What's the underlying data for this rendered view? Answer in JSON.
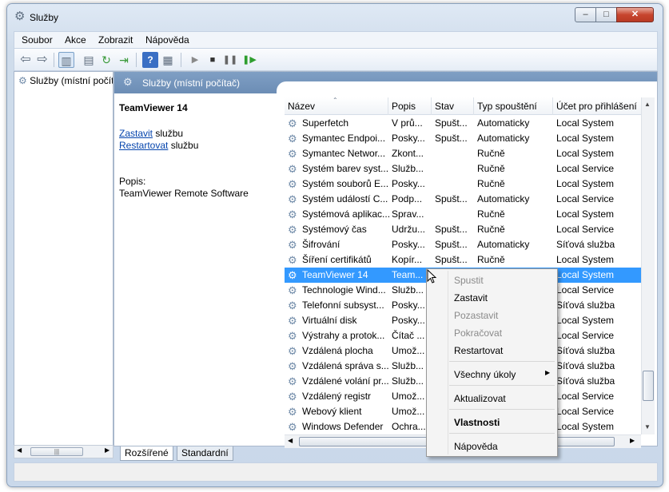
{
  "window": {
    "title": "Služby",
    "controls": {
      "minimize": "–",
      "maximize": "□",
      "close": "✕"
    }
  },
  "menu": [
    "Soubor",
    "Akce",
    "Zobrazit",
    "Nápověda"
  ],
  "toolbar": {
    "buttons": [
      "back-icon",
      "forward-icon",
      "console-tree-icon",
      "properties-icon",
      "refresh-icon",
      "export-icon",
      "help-icon",
      "view-icon",
      "play-icon",
      "stop-icon",
      "pause-icon",
      "resume-icon"
    ]
  },
  "left_pane": {
    "item": "Služby (místní počítač)"
  },
  "right_pane": {
    "title": "Služby (místní počítač)",
    "selected_service": "TeamViewer 14",
    "actions": [
      {
        "link": "Zastavit",
        "suffix": " službu"
      },
      {
        "link": "Restartovat",
        "suffix": " službu"
      }
    ],
    "description_label": "Popis:",
    "description": "TeamViewer Remote Software"
  },
  "table": {
    "columns": [
      "Název",
      "Popis",
      "Stav",
      "Typ spouštění",
      "Účet pro přihlášení"
    ],
    "rows": [
      [
        "Superfetch",
        "V prů...",
        "Spušt...",
        "Automaticky",
        "Local System"
      ],
      [
        "Symantec Endpoi...",
        "Posky...",
        "Spušt...",
        "Automaticky",
        "Local System"
      ],
      [
        "Symantec Networ...",
        "Zkont...",
        "",
        "Ručně",
        "Local System"
      ],
      [
        "Systém barev syst...",
        "Služb...",
        "",
        "Ručně",
        "Local Service"
      ],
      [
        "Systém souborů E...",
        "Posky...",
        "",
        "Ručně",
        "Local System"
      ],
      [
        "Systém událostí C...",
        "Podp...",
        "Spušt...",
        "Automaticky",
        "Local Service"
      ],
      [
        "Systémová aplikac...",
        "Sprav...",
        "",
        "Ručně",
        "Local System"
      ],
      [
        "Systémový čas",
        "Udržu...",
        "Spušt...",
        "Ručně",
        "Local Service"
      ],
      [
        "Šifrování",
        "Posky...",
        "Spušt...",
        "Automaticky",
        "Síťová služba"
      ],
      [
        "Šíření certifikátů",
        "Kopír...",
        "Spušt...",
        "Ručně",
        "Local System"
      ],
      [
        "TeamViewer 14",
        "Team...",
        "",
        "",
        "Local System"
      ],
      [
        "Technologie Wind...",
        "Služb...",
        "",
        "",
        "Local Service"
      ],
      [
        "Telefonní subsyst...",
        "Posky...",
        "",
        "",
        "Síťová služba"
      ],
      [
        "Virtuální disk",
        "Posky...",
        "",
        "",
        "Local System"
      ],
      [
        "Výstrahy a protok...",
        "Čítač ...",
        "",
        "",
        "Local Service"
      ],
      [
        "Vzdálená plocha",
        "Umož...",
        "",
        "",
        "Síťová služba"
      ],
      [
        "Vzdálená správa s...",
        "Služb...",
        "",
        "",
        "Síťová služba"
      ],
      [
        "Vzdálené volání pr...",
        "Služb...",
        "",
        "",
        "Síťová služba"
      ],
      [
        "Vzdálený registr",
        "Umož...",
        "",
        "",
        "Local Service"
      ],
      [
        "Webový klient",
        "Umož...",
        "",
        "",
        "Local Service"
      ],
      [
        "Windows Defender",
        "Ochra...",
        "",
        "",
        "Local System"
      ]
    ],
    "selected_index": 10
  },
  "tabs": [
    "Rozšířené",
    "Standardní"
  ],
  "active_tab": 0,
  "context_menu": {
    "items": [
      {
        "label": "Spustit",
        "enabled": false
      },
      {
        "label": "Zastavit",
        "enabled": true
      },
      {
        "label": "Pozastavit",
        "enabled": false
      },
      {
        "label": "Pokračovat",
        "enabled": false
      },
      {
        "label": "Restartovat",
        "enabled": true
      },
      {
        "label": "Všechny úkoly",
        "enabled": true,
        "submenu": true
      },
      {
        "label": "Aktualizovat",
        "enabled": true
      },
      {
        "label": "Vlastnosti",
        "enabled": true,
        "bold": true
      },
      {
        "label": "Nápověda",
        "enabled": true
      }
    ]
  },
  "colors": {
    "selection": "#3399ff",
    "header": "#6c8db5",
    "link": "#0645ad"
  }
}
